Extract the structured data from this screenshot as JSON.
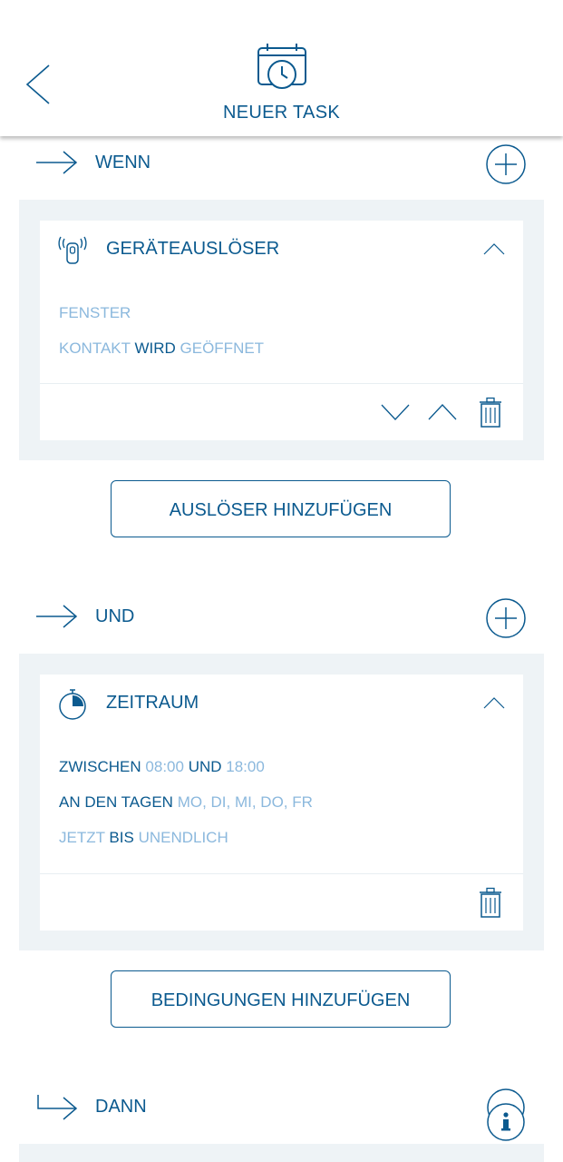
{
  "header": {
    "title": "NEUER TASK"
  },
  "sections": {
    "wenn": {
      "label": "WENN"
    },
    "und": {
      "label": "UND"
    },
    "dann": {
      "label": "DANN"
    }
  },
  "trigger_card": {
    "title": "GERÄTEAUSLÖSER",
    "line1": "FENSTER",
    "line2": {
      "a": "KONTAKT",
      "b": "WIRD",
      "c": "GEÖFFNET"
    }
  },
  "condition_card": {
    "title": "ZEITRAUM",
    "line1": {
      "a": "ZWISCHEN",
      "b": "08:00",
      "c": "UND",
      "d": "18:00"
    },
    "line2": {
      "a": "AN DEN TAGEN",
      "b": "MO, DI, MI, DO, FR"
    },
    "line3": {
      "a": "JETZT",
      "b": "BIS",
      "c": "UNENDLICH"
    }
  },
  "buttons": {
    "add_trigger": "AUSLÖSER HINZUFÜGEN",
    "add_condition": "BEDINGUNGEN HINZUFÜGEN"
  },
  "icons": {
    "back": "chevron-left-icon",
    "calendar": "calendar-clock-icon",
    "arrow": "arrow-right-icon",
    "plus": "plus-circle-icon",
    "sensor": "remote-sensor-icon",
    "timer": "stopwatch-icon",
    "collapse": "chevron-up-icon",
    "move_down": "chevron-down-icon",
    "move_up": "chevron-up-icon",
    "delete": "trash-icon",
    "info": "info-icon"
  },
  "colors": {
    "primary": "#0b5a8f",
    "light_text": "#8bb8dd",
    "panel_bg": "#eef3f6"
  }
}
